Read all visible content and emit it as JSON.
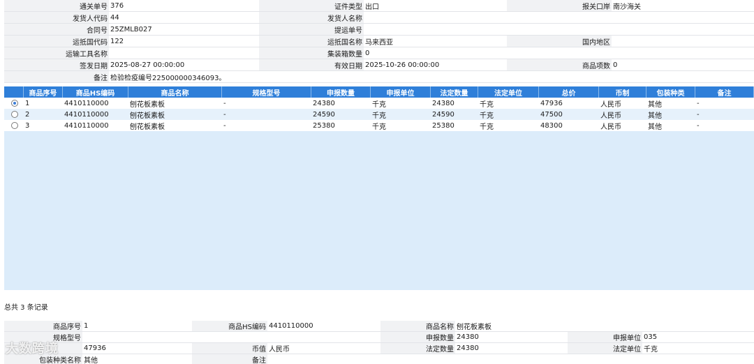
{
  "header": {
    "rows": [
      [
        {
          "label": "通关单号",
          "value": "376"
        },
        {
          "label": "证件类型",
          "value": "出口"
        },
        {
          "label": "报关口岸",
          "value": "南沙海关"
        }
      ],
      [
        {
          "label": "发货人代码",
          "value": "44"
        },
        {
          "label": "发货人名称",
          "value": ""
        },
        {
          "label": "",
          "value": ""
        }
      ],
      [
        {
          "label": "合同号",
          "value": "25ZMLB027"
        },
        {
          "label": "提运单号",
          "value": ""
        },
        {
          "label": "",
          "value": ""
        }
      ],
      [
        {
          "label": "运抵国代码",
          "value": "122"
        },
        {
          "label": "运抵国名称",
          "value": "马来西亚"
        },
        {
          "label": "国内地区",
          "value": ""
        }
      ],
      [
        {
          "label": "运输工具名称",
          "value": ""
        },
        {
          "label": "集装箱数量",
          "value": "0"
        },
        {
          "label": "",
          "value": ""
        }
      ],
      [
        {
          "label": "签发日期",
          "value": "2025-08-27 00:00:00"
        },
        {
          "label": "有效日期",
          "value": "2025-10-26 00:00:00"
        },
        {
          "label": "商品项数",
          "value": "0"
        }
      ]
    ],
    "note_label": "备注",
    "note_value": "检验检疫编号225000000346093。"
  },
  "grid": {
    "columns": [
      "商品序号",
      "商品HS编码",
      "商品名称",
      "规格型号",
      "申报数量",
      "申报单位",
      "法定数量",
      "法定单位",
      "总价",
      "币制",
      "包装种类",
      "备注"
    ],
    "rows": [
      {
        "selected": true,
        "cells": [
          "1",
          "4410110000",
          "刨花板素板",
          "-",
          "24380",
          "千克",
          "24380",
          "千克",
          "47936",
          "人民币",
          "其他",
          "-"
        ]
      },
      {
        "selected": false,
        "cells": [
          "2",
          "4410110000",
          "刨花板素板",
          "-",
          "24590",
          "千克",
          "24590",
          "千克",
          "47500",
          "人民币",
          "其他",
          "-"
        ]
      },
      {
        "selected": false,
        "cells": [
          "3",
          "4410110000",
          "刨花板素板",
          "-",
          "25380",
          "千克",
          "25380",
          "千克",
          "48300",
          "人民币",
          "其他",
          "-"
        ]
      }
    ]
  },
  "total_text": "总共 3 条记录",
  "detail": {
    "seq_label": "商品序号",
    "seq_value": "1",
    "hs_label": "商品HS编码",
    "hs_value": "4410110000",
    "name_label": "商品名称",
    "name_value": "刨花板素板",
    "spec_label": "规格型号",
    "spec_value": "",
    "decl_qty_label": "申报数量",
    "decl_qty_value": "24380",
    "decl_unit_label": "申报单位",
    "decl_unit_value": "035",
    "price_value": "47936",
    "currency_label": "币值",
    "currency_value": "人民币",
    "legal_qty_label": "法定数量",
    "legal_qty_value": "24380",
    "legal_unit_label": "法定单位",
    "legal_unit_value": "千克",
    "pack_label": "包装种类名称",
    "pack_value": "其他",
    "remark_label": "备注",
    "remark_value": ""
  },
  "watermark": "大数跨境"
}
